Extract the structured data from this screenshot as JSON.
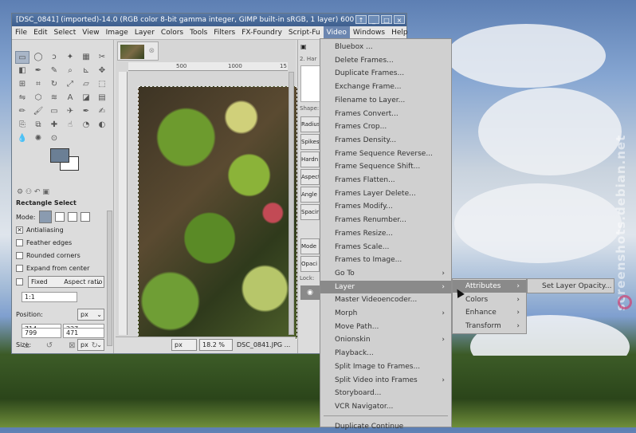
{
  "window": {
    "title": "[DSC_0841] (imported)-14.0 (RGB color 8-bit gamma integer, GIMP built-in sRGB, 1 layer) 600",
    "buttons": [
      "↑",
      "_",
      "□",
      "×"
    ]
  },
  "menubar": [
    "File",
    "Edit",
    "Select",
    "View",
    "Image",
    "Layer",
    "Colors",
    "Tools",
    "Filters",
    "FX-Foundry",
    "Script-Fu",
    "Video",
    "Windows",
    "Help"
  ],
  "active_menu": "Video",
  "tool_options": {
    "title": "Rectangle Select",
    "mode_label": "Mode:",
    "antialiasing": "Antialiasing",
    "feather": "Feather edges",
    "rounded": "Rounded corners",
    "expand": "Expand from center",
    "fixed": "Fixed",
    "aspect": "Aspect ratio",
    "ratio": "1:1",
    "position_label": "Position:",
    "position_unit": "px",
    "pos_x": "714",
    "pos_y": "227",
    "size_label": "Size:",
    "size_unit": "px",
    "size_w": "799",
    "size_h": "471"
  },
  "image": {
    "ruler_marks": [
      "500",
      "1000",
      "15"
    ],
    "unit": "px",
    "zoom": "18.2 %",
    "filename": "DSC_0841.JPG ..."
  },
  "dock": {
    "header": "2. Har",
    "shape_label": "Shape:",
    "radius": "Radius",
    "spikes": "Spikes",
    "hardness": "Hardn",
    "aspect": "Aspect",
    "angle": "Angle",
    "spacing": "Spacin",
    "mode": "Mode",
    "opacity": "Opaci",
    "lock": "Lock:"
  },
  "video_menu": [
    {
      "label": "Bluebox ...",
      "sub": false
    },
    {
      "label": "Delete Frames...",
      "sub": false
    },
    {
      "label": "Duplicate Frames...",
      "sub": false
    },
    {
      "label": "Exchange Frame...",
      "sub": false
    },
    {
      "label": "Filename to Layer...",
      "sub": false
    },
    {
      "label": "Frames Convert...",
      "sub": false
    },
    {
      "label": "Frames Crop...",
      "sub": false
    },
    {
      "label": "Frames Density...",
      "sub": false
    },
    {
      "label": "Frame Sequence Reverse...",
      "sub": false
    },
    {
      "label": "Frame Sequence Shift...",
      "sub": false
    },
    {
      "label": "Frames Flatten...",
      "sub": false
    },
    {
      "label": "Frames Layer Delete...",
      "sub": false
    },
    {
      "label": "Frames Modify...",
      "sub": false
    },
    {
      "label": "Frames Renumber...",
      "sub": false
    },
    {
      "label": "Frames Resize...",
      "sub": false
    },
    {
      "label": "Frames Scale...",
      "sub": false
    },
    {
      "label": "Frames to Image...",
      "sub": false
    },
    {
      "label": "Go To",
      "sub": true
    },
    {
      "label": "Layer",
      "sub": true,
      "highlighted": true
    },
    {
      "label": "Master Videoencoder...",
      "sub": false
    },
    {
      "label": "Morph",
      "sub": true
    },
    {
      "label": "Move Path...",
      "sub": false
    },
    {
      "label": "Onionskin",
      "sub": true
    },
    {
      "label": "Playback...",
      "sub": false
    },
    {
      "label": "Split Image to Frames...",
      "sub": false
    },
    {
      "label": "Split Video into Frames",
      "sub": true
    },
    {
      "label": "Storyboard...",
      "sub": false
    },
    {
      "label": "VCR Navigator...",
      "sub": false
    },
    {
      "label": "Duplicate Continue",
      "sub": false
    }
  ],
  "layer_submenu": [
    {
      "label": "Attributes",
      "highlighted": true
    },
    {
      "label": "Colors"
    },
    {
      "label": "Enhance"
    },
    {
      "label": "Transform"
    }
  ],
  "attributes_submenu": [
    "Set Layer Opacity..."
  ],
  "watermark": "screenshots.debian.net"
}
